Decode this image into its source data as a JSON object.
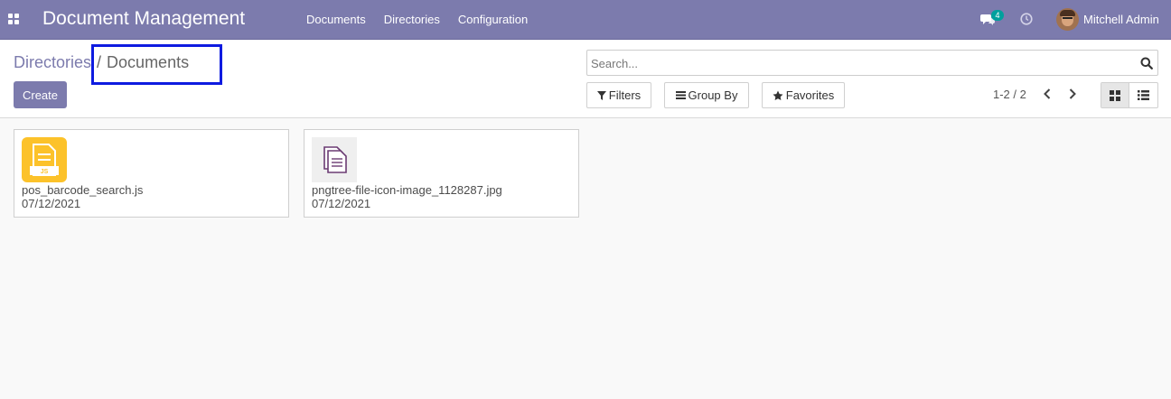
{
  "navbar": {
    "app_title": "Document Management",
    "menu": [
      "Documents",
      "Directories",
      "Configuration"
    ],
    "chat_count": "4",
    "user_name": "Mitchell Admin",
    "color": "#7c7bad"
  },
  "breadcrumb": {
    "parent": "Directories",
    "separator": "/",
    "current": "Documents"
  },
  "toolbar": {
    "create_label": "Create"
  },
  "search": {
    "placeholder": "Search..."
  },
  "filters": {
    "filters_label": "Filters",
    "group_by_label": "Group By",
    "favorites_label": "Favorites"
  },
  "pager": {
    "value": "1-2 / 2"
  },
  "documents": [
    {
      "name": "pos_barcode_search.js",
      "date": "07/12/2021",
      "icon": "js-file-icon"
    },
    {
      "name": "pngtree-file-icon-image_1128287.jpg",
      "date": "07/12/2021",
      "icon": "image-file-icon"
    }
  ]
}
